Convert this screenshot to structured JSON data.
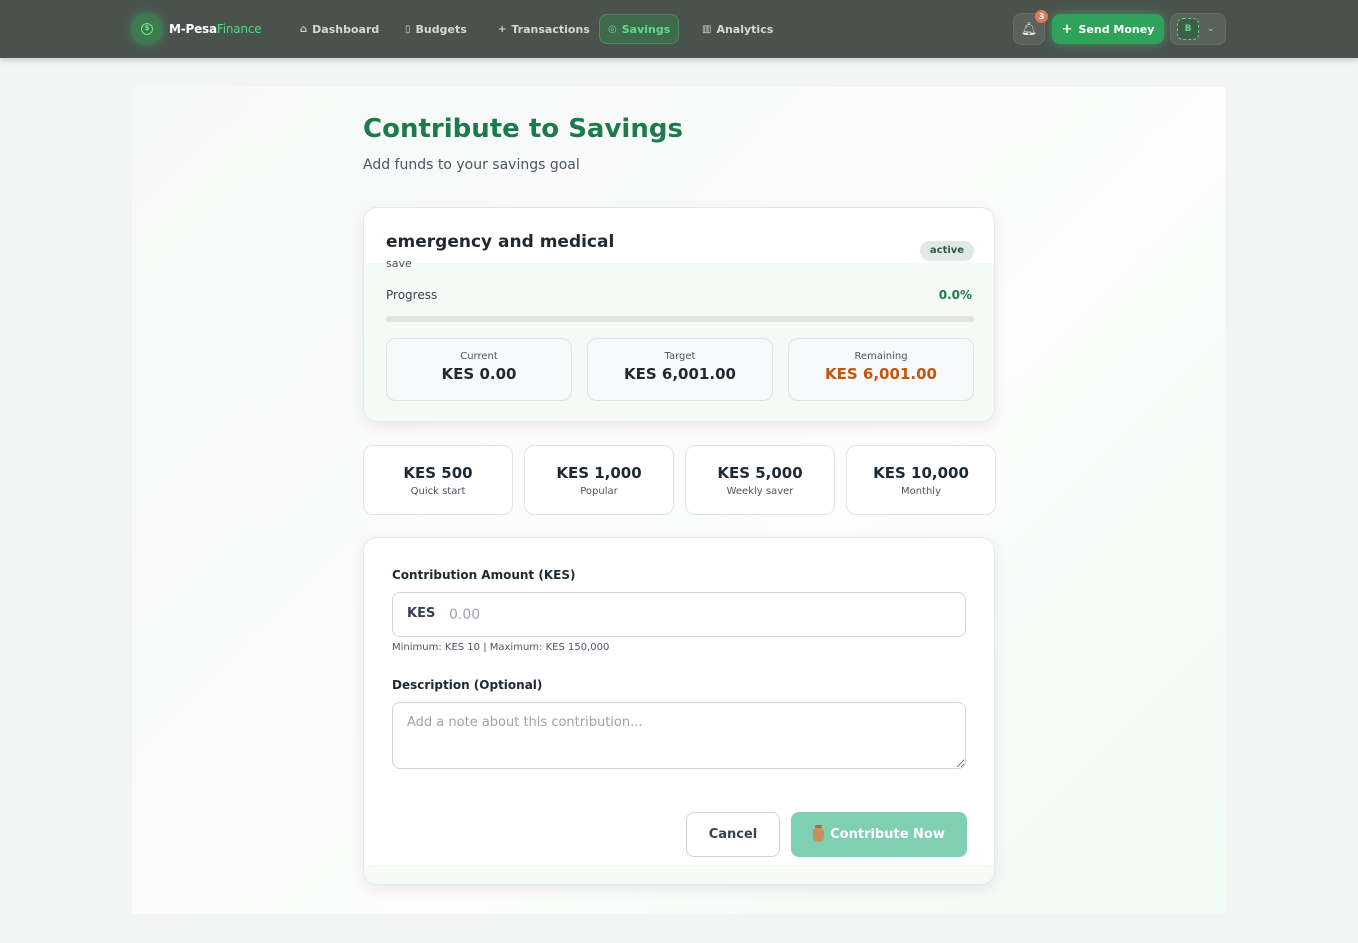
{
  "navbar": {
    "brand": "M-Pesa",
    "brand_accent": "Finance",
    "items": [
      {
        "label": "Dashboard",
        "icon": "home-icon"
      },
      {
        "label": "Budgets",
        "icon": "document-icon"
      },
      {
        "label": "Transactions",
        "icon": "plus-icon"
      },
      {
        "label": "Savings",
        "icon": "coin-icon",
        "active": true
      },
      {
        "label": "Analytics",
        "icon": "bar-chart-icon"
      }
    ],
    "notification_count": "3",
    "send_money_label": "Send Money",
    "user_initial": "B"
  },
  "header": {
    "title": "Contribute to Savings",
    "subtitle": "Add funds to your savings goal"
  },
  "goal": {
    "name": "emergency and medical",
    "description": "save",
    "status": "active",
    "progress_label": "Progress",
    "progress_percent_text": "0.0%",
    "progress_fraction": 0.0,
    "stats": [
      {
        "label": "Current",
        "value": "KES 0.00"
      },
      {
        "label": "Target",
        "value": "KES 6,001.00"
      },
      {
        "label": "Remaining",
        "value": "KES 6,001.00"
      }
    ]
  },
  "quick_amounts": [
    {
      "amount": "KES 500",
      "label": "Quick start"
    },
    {
      "amount": "KES 1,000",
      "label": "Popular"
    },
    {
      "amount": "KES 5,000",
      "label": "Weekly saver"
    },
    {
      "amount": "KES 10,000",
      "label": "Monthly"
    }
  ],
  "form": {
    "amount_label": "Contribution Amount (KES)",
    "amount_prefix": "KES",
    "amount_value": "",
    "amount_placeholder": "0.00",
    "amount_help": "Minimum: KES 10 | Maximum: KES 150,000",
    "description_label": "Description (Optional)",
    "description_value": "",
    "description_placeholder": "Add a note about this contribution...",
    "cancel_label": "Cancel",
    "submit_label": "Contribute Now"
  },
  "colors": {
    "accent": "#1d7a4c",
    "remaining": "#c2560c",
    "submit_disabled": "#7fcfb2"
  }
}
